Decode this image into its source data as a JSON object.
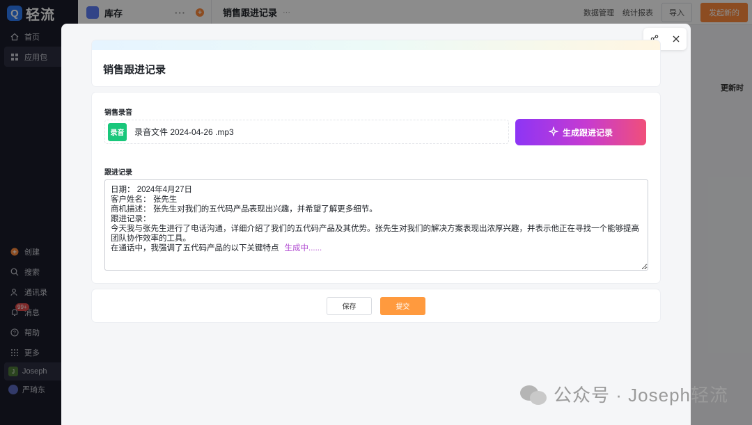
{
  "brand": {
    "name": "轻流",
    "logo_letter": "Q"
  },
  "sidebar": {
    "items": [
      {
        "label": "首页",
        "icon": "home-icon"
      },
      {
        "label": "应用包",
        "icon": "apps-icon"
      }
    ],
    "bottom_items": [
      {
        "label": "创建",
        "icon": "plus-icon"
      },
      {
        "label": "搜索",
        "icon": "search-icon"
      },
      {
        "label": "通讯录",
        "icon": "contacts-icon"
      },
      {
        "label": "消息",
        "icon": "bell-icon",
        "badge": "99+"
      },
      {
        "label": "帮助",
        "icon": "help-icon"
      },
      {
        "label": "更多",
        "icon": "grid-icon"
      }
    ],
    "workspace": "Joseph",
    "workspace_initial": "J",
    "user": "严琦东"
  },
  "panel": {
    "title": "库存",
    "more": "···"
  },
  "topbar": {
    "title": "销售跟进记录",
    "more": "···",
    "actions": [
      "数据管理",
      "统计报表"
    ],
    "import_label": "导入",
    "primary_label": "发起新的",
    "updated_label": "更新时"
  },
  "modal": {
    "form_title": "销售跟进记录",
    "audio_label": "销售录音",
    "file_tag": "录音",
    "file_name": "录音文件 2024-04-26 .mp3",
    "generate_label": "生成跟进记录",
    "record_label": "跟进记录",
    "record_lines": [
      "日期： 2024年4月27日",
      "客户姓名： 张先生",
      "商机描述： 张先生对我们的五代码产品表现出兴趣，并希望了解更多细节。",
      "跟进记录：",
      "今天我与张先生进行了电话沟通，详细介绍了我们的五代码产品及其优势。张先生对我们的解决方案表现出浓厚兴趣，并表示他正在寻找一个能够提高团队协作效率的工具。",
      "在通话中，我强调了五代码产品的以下关键特点"
    ],
    "generating_text": "生成中......",
    "save_label": "保存",
    "submit_label": "提交"
  },
  "watermark": {
    "text": "公众号 · Joseph轻流"
  },
  "colors": {
    "accent_orange": "#ff9a3e",
    "generate_gradient_start": "#8d35f5",
    "generate_gradient_end": "#f04f7a",
    "file_tag_green": "#19c77b",
    "generating_purple": "#b04ad1"
  }
}
